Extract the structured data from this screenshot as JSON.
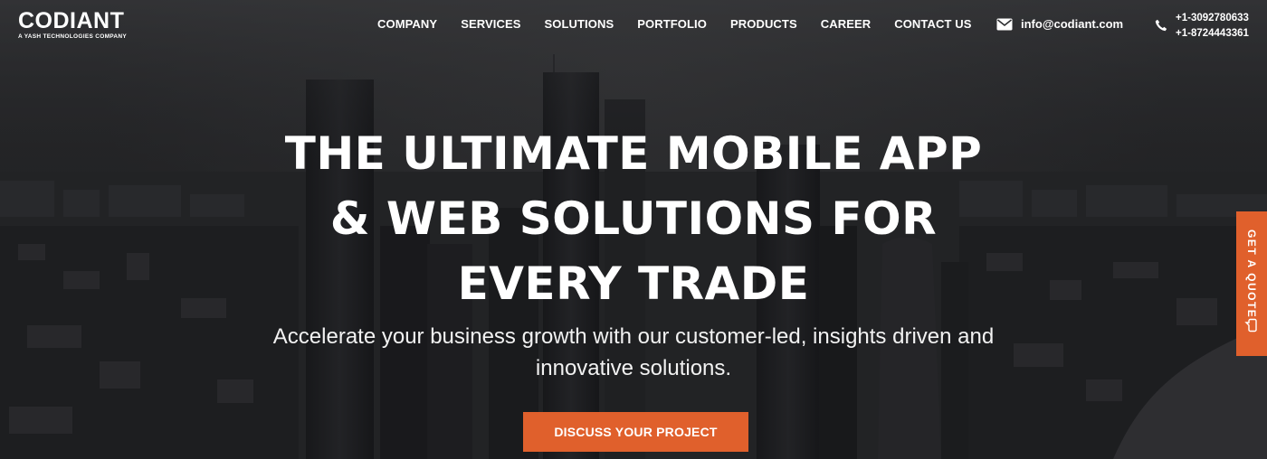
{
  "brand": {
    "name": "CODIANT",
    "tagline": "A YASH TECHNOLOGIES COMPANY"
  },
  "nav": {
    "items": [
      "COMPANY",
      "SERVICES",
      "SOLUTIONS",
      "PORTFOLIO",
      "PRODUCTS",
      "CAREER",
      "CONTACT US"
    ]
  },
  "contact": {
    "email": "info@codiant.com",
    "phones": [
      "+1-3092780633",
      "+1-8724443361"
    ],
    "email_icon": "envelope-icon",
    "phone_icon": "phone-icon"
  },
  "hero": {
    "headline_lines": [
      "THE ULTIMATE MOBILE APP",
      "& WEB SOLUTIONS FOR",
      "EVERY TRADE"
    ],
    "subtext_lines": [
      "Accelerate your business growth with our customer-led, insights driven and",
      "innovative solutions."
    ],
    "cta_label": "DISCUSS YOUR PROJECT"
  },
  "side_tab": {
    "label": "GET A QUOTE",
    "icon": "chat-icon"
  },
  "colors": {
    "accent": "#e0602c",
    "overlay": "#232426"
  }
}
